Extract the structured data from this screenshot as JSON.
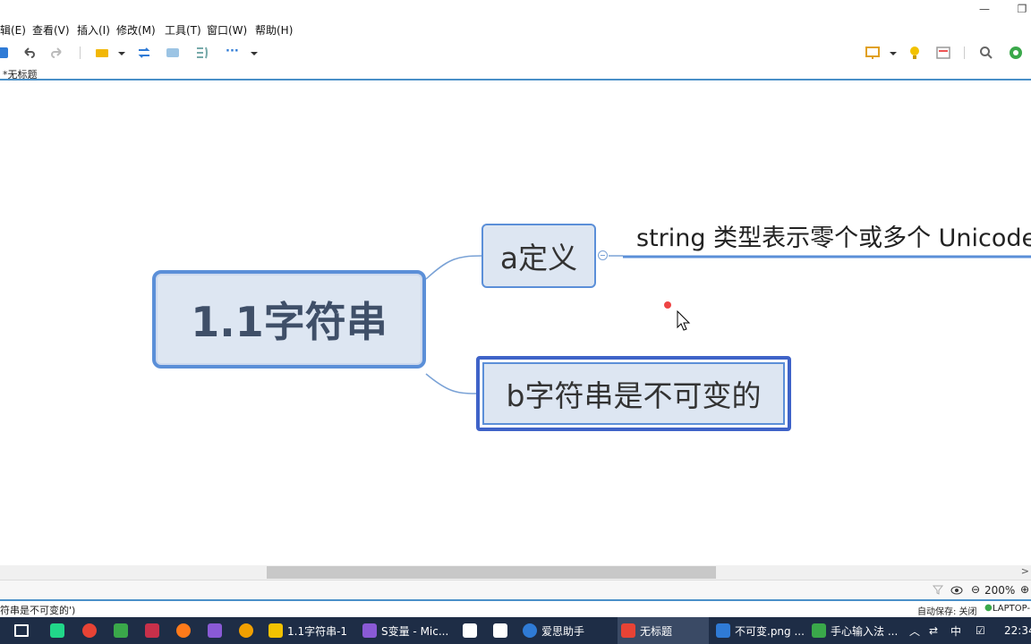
{
  "window": {
    "minimize_label": "—",
    "restore_label": "❐"
  },
  "menubar": {
    "items": [
      {
        "label": "辑(E)"
      },
      {
        "label": "查看(V)"
      },
      {
        "label": "插入(I)"
      },
      {
        "label": "修改(M)"
      },
      {
        "label": "工具(T)"
      },
      {
        "label": "窗口(W)"
      },
      {
        "label": "帮助(H)"
      }
    ]
  },
  "toolbar": {
    "more_label": "···"
  },
  "document": {
    "tab_label": "*无标题"
  },
  "mindmap": {
    "central_topic": "1.1字符串",
    "topic_a": "a定义",
    "topic_a_subtopic": "string 类型表示零个或多个 Unicode",
    "topic_b": "b字符串是不可变的"
  },
  "zoom": {
    "value": "200%",
    "minus_label": "⊖",
    "plus_label": "⊕"
  },
  "status": {
    "left_text": "符串是不可变的')",
    "autosave": "自动保存: 关闭",
    "machine": "LAPTOP-"
  },
  "taskbar": {
    "items": [
      {
        "label": "1.1字符串-1"
      },
      {
        "label": "S变量 - Mic..."
      },
      {
        "label": "爱思助手"
      },
      {
        "label": "无标题"
      },
      {
        "label": "不可变.png ..."
      },
      {
        "label": "手心输入法 ..."
      }
    ],
    "ime": "中",
    "clock": "22:34"
  },
  "colors": {
    "topic_border": "#5b8fd8",
    "topic_fill": "#dde6f2",
    "accent": "#4a90c8",
    "taskbar_bg": "#1e2d46"
  }
}
